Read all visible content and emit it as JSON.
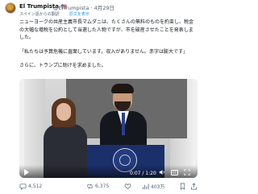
{
  "tweet": {
    "author_name": "El Trumpista",
    "author_badge": "🇺🇸",
    "handle_date": "@ElTrumpista · 4月29日",
    "translated_from": "スペイン語からの翻訳",
    "show_original": "原文を表示",
    "paragraphs": [
      "ニューヨークの共産主義市長マムダニは、たくさんの無料のものを約束し、税金の大幅な増税を公約として当選した人物ですが、市を破産させたことを発表しました。",
      "「私たちは予算危機に直面しています。収入がありません。赤字は膨大です」",
      "さらに、トランプに助けを求めました。"
    ]
  },
  "video": {
    "time": "0:07 / 1:20"
  },
  "actions": {
    "replies": "4,512",
    "retweets": "6,375",
    "likes": "",
    "views": "403万"
  },
  "colors": {
    "link": "#1d9bf0",
    "muted": "#536471"
  }
}
